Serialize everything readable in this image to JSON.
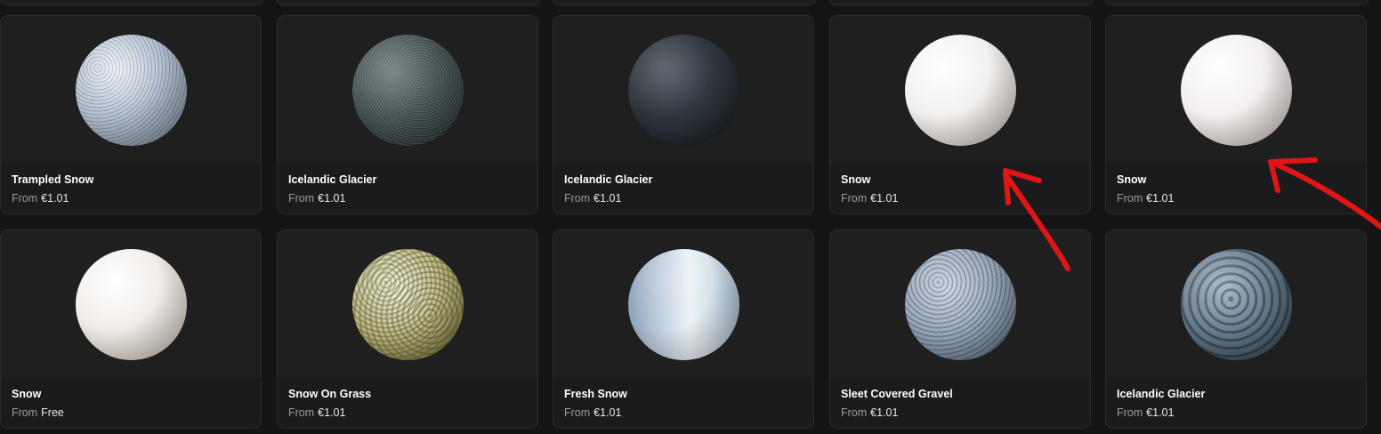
{
  "grid": {
    "price_prefix": "From",
    "cards": [
      {
        "title": "Trampled Snow",
        "price": "€1.01",
        "material": "trampled-snow"
      },
      {
        "title": "Icelandic Glacier",
        "price": "€1.01",
        "material": "icelandic-glacier"
      },
      {
        "title": "Icelandic Glacier",
        "price": "€1.01",
        "material": "icelandic-glacier-dark"
      },
      {
        "title": "Snow",
        "price": "€1.01",
        "material": "snow"
      },
      {
        "title": "Snow",
        "price": "€1.01",
        "material": "snow"
      },
      {
        "title": "Snow",
        "price": "Free",
        "material": "snow"
      },
      {
        "title": "Snow On Grass",
        "price": "€1.01",
        "material": "snow-on-grass"
      },
      {
        "title": "Fresh Snow",
        "price": "€1.01",
        "material": "fresh-snow"
      },
      {
        "title": "Sleet Covered Gravel",
        "price": "€1.01",
        "material": "sleet-covered-gravel"
      },
      {
        "title": "Icelandic Glacier",
        "price": "€1.01",
        "material": "icelandic-glacier-cracked"
      }
    ]
  },
  "annotations": {
    "arrow_color": "#e01515",
    "arrows": [
      "red-arrow-pointing-to-snow-card-4",
      "red-arrow-pointing-to-snow-card-5"
    ]
  }
}
